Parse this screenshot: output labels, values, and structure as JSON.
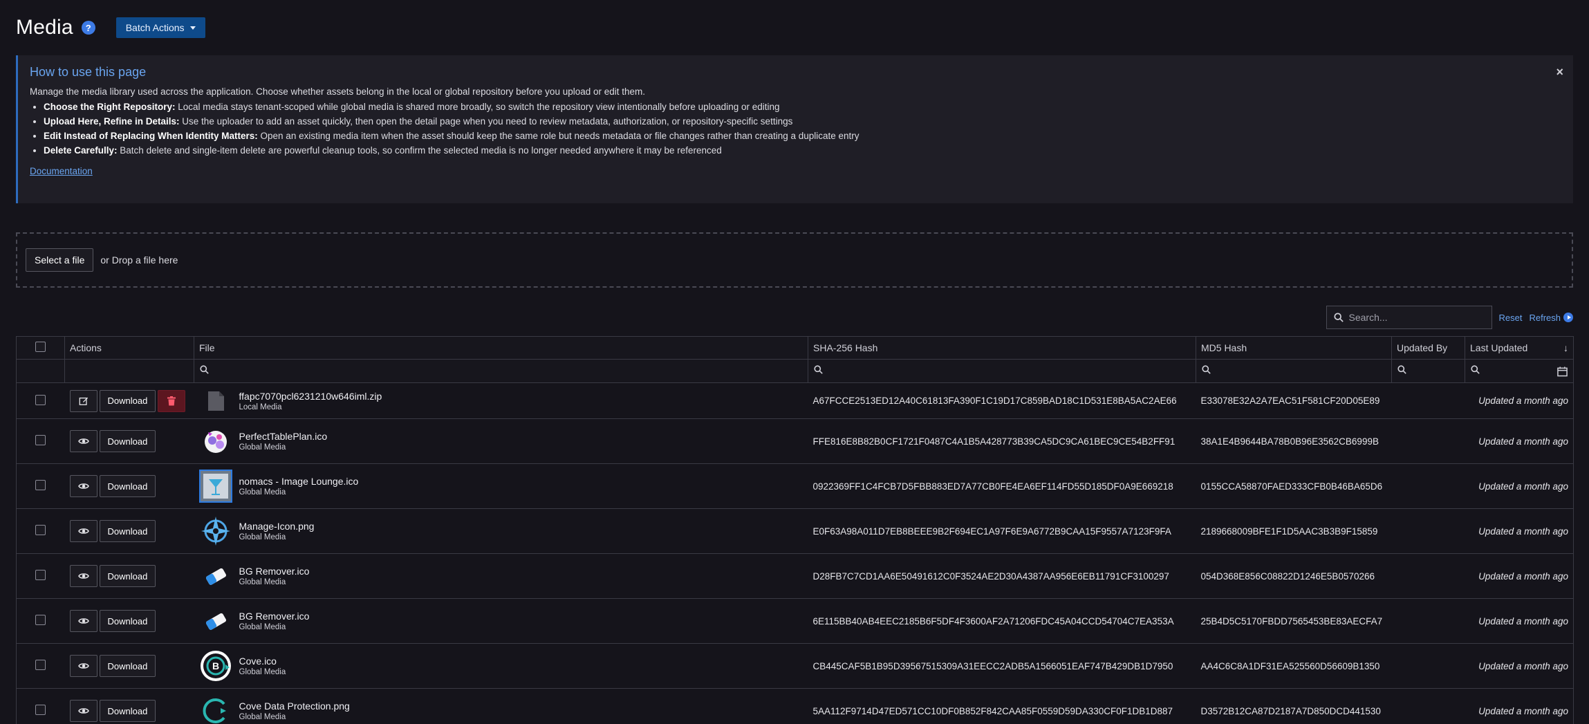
{
  "header": {
    "title": "Media",
    "help_icon": "?",
    "batch_label": "Batch Actions"
  },
  "info": {
    "title": "How to use this page",
    "close": "×",
    "intro": "Manage the media library used across the application. Choose whether assets belong in the local or global repository before you upload or edit them.",
    "tips": [
      {
        "label": "Choose the Right Repository:",
        "text": " Local media stays tenant-scoped while global media is shared more broadly, so switch the repository view intentionally before uploading or editing"
      },
      {
        "label": "Upload Here, Refine in Details:",
        "text": " Use the uploader to add an asset quickly, then open the detail page when you need to review metadata, authorization, or repository-specific settings"
      },
      {
        "label": "Edit Instead of Replacing When Identity Matters:",
        "text": " Open an existing media item when the asset should keep the same role but needs metadata or file changes rather than creating a duplicate entry"
      },
      {
        "label": "Delete Carefully:",
        "text": " Batch delete and single-item delete are powerful cleanup tools, so confirm the selected media is no longer needed anywhere it may be referenced"
      }
    ],
    "doc_link": "Documentation"
  },
  "upload": {
    "select_label": "Select a file",
    "drop_text": "or Drop a file here"
  },
  "toolbar": {
    "search_placeholder": "Search...",
    "reset": "Reset",
    "refresh": "Refresh"
  },
  "table": {
    "columns": [
      "Actions",
      "File",
      "SHA-256 Hash",
      "MD5 Hash",
      "Updated By",
      "Last Updated"
    ],
    "download_label": "Download",
    "rows": [
      {
        "name": "ffapc7070pcl6231210w646iml.zip",
        "repo": "Local Media",
        "sha": "A67FCCE2513ED12A40C61813FA390F1C19D17C859BAD18C1D531E8BA5AC2AE66",
        "md5": "E33078E32A2A7EAC51F581CF20D05E89",
        "updated_by": "",
        "updated": "Updated a month ago",
        "kind": "zip",
        "local": true
      },
      {
        "name": "PerfectTablePlan.ico",
        "repo": "Global Media",
        "sha": "FFE816E8B82B0CF1721F0487C4A1B5A428773B39CA5DC9CA61BEC9CE54B2FF91",
        "md5": "38A1E4B9644BA78B0B96E3562CB6999B",
        "updated_by": "",
        "updated": "Updated a month ago",
        "kind": "ptp",
        "local": false
      },
      {
        "name": "nomacs - Image Lounge.ico",
        "repo": "Global Media",
        "sha": "0922369FF1C4FCB7D5FBB883ED7A77CB0FE4EA6EF114FD55D185DF0A9E669218",
        "md5": "0155CCA58870FAED333CFB0B46BA65D6",
        "updated_by": "",
        "updated": "Updated a month ago",
        "kind": "nomacs",
        "local": false
      },
      {
        "name": "Manage-Icon.png",
        "repo": "Global Media",
        "sha": "E0F63A98A011D7EB8BEEE9B2F694EC1A97F6E9A6772B9CAA15F9557A7123F9FA",
        "md5": "2189668009BFE1F1D5AAC3B3B9F15859",
        "updated_by": "",
        "updated": "Updated a month ago",
        "kind": "compass",
        "local": false
      },
      {
        "name": "BG Remover.ico",
        "repo": "Global Media",
        "sha": "D28FB7C7CD1AA6E50491612C0F3524AE2D30A4387AA956E6EB11791CF3100297",
        "md5": "054D368E856C08822D1246E5B0570266",
        "updated_by": "",
        "updated": "Updated a month ago",
        "kind": "eraser",
        "local": false
      },
      {
        "name": "BG Remover.ico",
        "repo": "Global Media",
        "sha": "6E115BB40AB4EEC2185B6F5DF4F3600AF2A71206FDC45A04CCD54704C7EA353A",
        "md5": "25B4D5C5170FBDD7565453BE83AECFA7",
        "updated_by": "",
        "updated": "Updated a month ago",
        "kind": "eraser",
        "local": false
      },
      {
        "name": "Cove.ico",
        "repo": "Global Media",
        "sha": "CB445CAF5B1B95D39567515309A31EECC2ADB5A1566051EAF747B429DB1D7950",
        "md5": "AA4C6C8A1DF31EA525560D56609B1350",
        "updated_by": "",
        "updated": "Updated a month ago",
        "kind": "cove",
        "local": false
      },
      {
        "name": "Cove Data Protection.png",
        "repo": "Global Media",
        "sha": "5AA112F9714D47ED571CC10DF0B852F842CAA85F0559D59DA330CF0F1DB1D887",
        "md5": "D3572B12CA87D2187A7D850DCD441530",
        "updated_by": "",
        "updated": "Updated a month ago",
        "kind": "covedp",
        "local": false
      }
    ]
  },
  "icons": [
    "help-icon",
    "caret-down-icon",
    "close-icon",
    "search-icon",
    "refresh-icon",
    "edit-icon",
    "eye-icon",
    "trash-icon",
    "calendar-icon",
    "sort-icon"
  ],
  "colors": {
    "accent": "#3d7be6",
    "link": "#6aa5f0",
    "danger": "#5c1620",
    "background": "#15141b"
  }
}
